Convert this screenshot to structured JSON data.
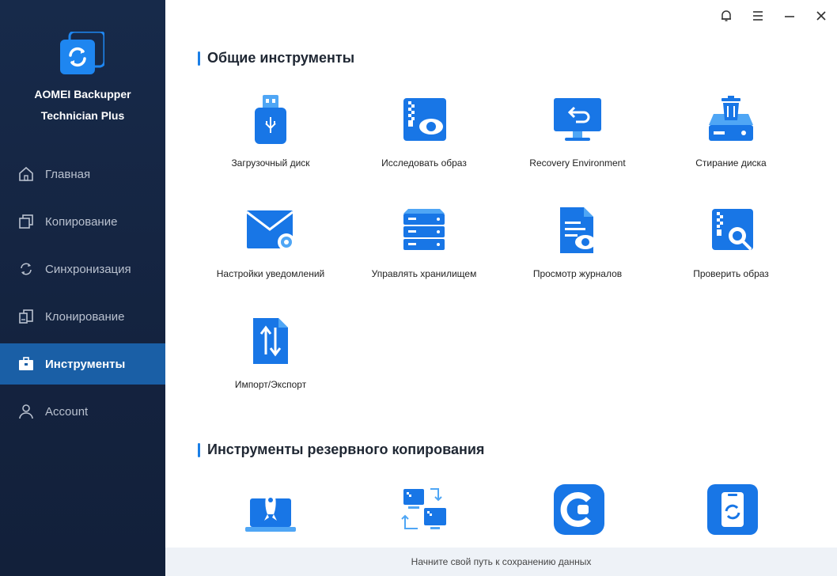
{
  "app": {
    "name_line1": "AOMEI Backupper",
    "name_line2": "Technician Plus"
  },
  "window_controls": {
    "notifications": "bell-icon",
    "menu": "menu-icon",
    "minimize": "minimize-icon",
    "close": "close-icon"
  },
  "sidebar": {
    "items": [
      {
        "label": "Главная",
        "icon": "home-icon"
      },
      {
        "label": "Копирование",
        "icon": "backup-icon"
      },
      {
        "label": "Синхронизация",
        "icon": "sync-icon"
      },
      {
        "label": "Клонирование",
        "icon": "clone-icon"
      },
      {
        "label": "Инструменты",
        "icon": "toolbox-icon",
        "active": true
      },
      {
        "label": "Account",
        "icon": "user-icon"
      }
    ]
  },
  "sections": {
    "common": {
      "title": "Общие инструменты",
      "tools": [
        {
          "label": "Загрузочный диск",
          "icon": "usb-drive-icon"
        },
        {
          "label": "Исследовать образ",
          "icon": "explore-image-icon"
        },
        {
          "label": "Recovery Environment",
          "icon": "recovery-environment-icon"
        },
        {
          "label": "Стирание диска",
          "icon": "disk-wipe-icon"
        },
        {
          "label": "Настройки уведомлений",
          "icon": "email-settings-icon"
        },
        {
          "label": "Управлять хранилищем",
          "icon": "storage-manager-icon"
        },
        {
          "label": "Просмотр журналов",
          "icon": "view-logs-icon"
        },
        {
          "label": "Проверить образ",
          "icon": "check-image-icon"
        },
        {
          "label": "Импорт/Экспорт",
          "icon": "import-export-icon"
        }
      ]
    },
    "backup_tools": {
      "title": "Инструменты резервного копирования",
      "tools": [
        {
          "icon": "launch-backup-icon"
        },
        {
          "icon": "image-deploy-icon"
        },
        {
          "icon": "centralized-backupper-icon"
        },
        {
          "icon": "phone-backup-icon"
        }
      ]
    }
  },
  "footer": {
    "text": "Начните свой путь к сохранению данных"
  },
  "colors": {
    "sidebar_bg": "#14233f",
    "active_item": "#1a5fa6",
    "accent": "#1a7ee6"
  }
}
